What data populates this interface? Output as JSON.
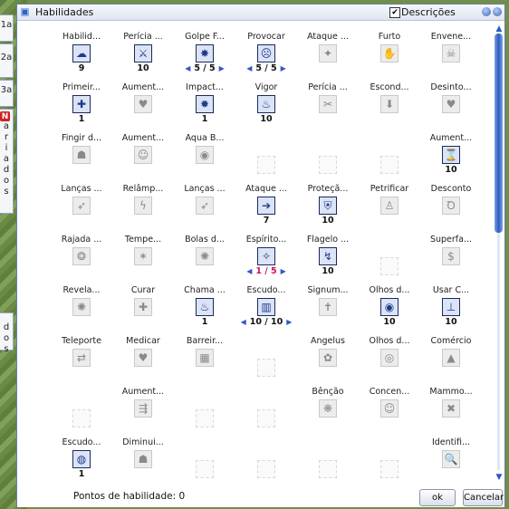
{
  "side_tabs": {
    "tab1": "1a",
    "tab2": "2a",
    "tab3": "3a",
    "tab4_badge": "N",
    "tab4_letters": [
      "a",
      "r",
      "i",
      "a",
      "d",
      "o",
      "s"
    ],
    "tab5_letters": [
      "d",
      "o",
      "s"
    ]
  },
  "window": {
    "title": "Habilidades",
    "descriptions_label": "Descrições",
    "descriptions_checked": "✔"
  },
  "skills": [
    {
      "name": "Habilid...",
      "level": "9",
      "active": true,
      "glyph": "☁"
    },
    {
      "name": "Perícia ...",
      "level": "10",
      "active": true,
      "glyph": "⚔"
    },
    {
      "name": "Golpe F...",
      "level": "5 / 5",
      "active": true,
      "glyph": "✸",
      "arrows": true
    },
    {
      "name": "Provocar",
      "level": "5 / 5",
      "active": true,
      "glyph": "☹",
      "arrows": true
    },
    {
      "name": "Ataque ...",
      "level": "",
      "active": false,
      "glyph": "✦"
    },
    {
      "name": "Furto",
      "level": "",
      "active": false,
      "glyph": "✋"
    },
    {
      "name": "Envene...",
      "level": "",
      "active": false,
      "glyph": "☠"
    },
    {
      "name": "Primeir...",
      "level": "1",
      "active": true,
      "glyph": "✚"
    },
    {
      "name": "Aument...",
      "level": "",
      "active": false,
      "glyph": "♥"
    },
    {
      "name": "Impact...",
      "level": "1",
      "active": true,
      "glyph": "✹"
    },
    {
      "name": "Vigor",
      "level": "10",
      "active": true,
      "glyph": "♨"
    },
    {
      "name": "Perícia ...",
      "level": "",
      "active": false,
      "glyph": "✂"
    },
    {
      "name": "Escond...",
      "level": "",
      "active": false,
      "glyph": "⬇"
    },
    {
      "name": "Desinto...",
      "level": "",
      "active": false,
      "glyph": "♥"
    },
    {
      "name": "Fingir d...",
      "level": "",
      "active": false,
      "glyph": "☗"
    },
    {
      "name": "Aument...",
      "level": "",
      "active": false,
      "glyph": "☺"
    },
    {
      "name": "Aqua B...",
      "level": "",
      "active": false,
      "glyph": "◉"
    },
    {
      "name": "",
      "level": "",
      "empty": true
    },
    {
      "name": "",
      "level": "",
      "empty": true
    },
    {
      "name": "",
      "level": "",
      "empty": true
    },
    {
      "name": "Aument...",
      "level": "10",
      "active": true,
      "glyph": "⌛"
    },
    {
      "name": "Lanças ...",
      "level": "",
      "active": false,
      "glyph": "➶"
    },
    {
      "name": "Relâmp...",
      "level": "",
      "active": false,
      "glyph": "ϟ"
    },
    {
      "name": "Lanças ...",
      "level": "",
      "active": false,
      "glyph": "➶"
    },
    {
      "name": "Ataque ...",
      "level": "7",
      "active": true,
      "glyph": "➔"
    },
    {
      "name": "Proteçã...",
      "level": "10",
      "active": true,
      "glyph": "⛨"
    },
    {
      "name": "Petrificar",
      "level": "",
      "active": false,
      "glyph": "♙"
    },
    {
      "name": "Desconto",
      "level": "",
      "active": false,
      "glyph": "Ꝺ"
    },
    {
      "name": "Rajada ...",
      "level": "",
      "active": false,
      "glyph": "❂"
    },
    {
      "name": "Tempe...",
      "level": "",
      "active": false,
      "glyph": "✶"
    },
    {
      "name": "Bolas d...",
      "level": "",
      "active": false,
      "glyph": "✺"
    },
    {
      "name": "Espírito...",
      "level": "1 / 5",
      "active": true,
      "glyph": "✧",
      "arrows": true,
      "red": true
    },
    {
      "name": "Flagelo ...",
      "level": "10",
      "active": true,
      "glyph": "↯"
    },
    {
      "name": "",
      "level": "",
      "empty": true
    },
    {
      "name": "Superfa...",
      "level": "",
      "active": false,
      "glyph": "$"
    },
    {
      "name": "Revela...",
      "level": "",
      "active": false,
      "glyph": "✺"
    },
    {
      "name": "Curar",
      "level": "",
      "active": false,
      "glyph": "✚"
    },
    {
      "name": "Chama ...",
      "level": "1",
      "active": true,
      "glyph": "♨"
    },
    {
      "name": "Escudo...",
      "level": "10 / 10",
      "active": true,
      "glyph": "▥",
      "arrows": true
    },
    {
      "name": "Signum...",
      "level": "",
      "active": false,
      "glyph": "✝"
    },
    {
      "name": "Olhos d...",
      "level": "10",
      "active": true,
      "glyph": "◉"
    },
    {
      "name": "Usar C...",
      "level": "10",
      "active": true,
      "glyph": "⊥"
    },
    {
      "name": "Teleporte",
      "level": "",
      "active": false,
      "glyph": "⇄"
    },
    {
      "name": "Medicar",
      "level": "",
      "active": false,
      "glyph": "♥"
    },
    {
      "name": "Barreir...",
      "level": "",
      "active": false,
      "glyph": "▦"
    },
    {
      "name": "",
      "level": "",
      "empty": true
    },
    {
      "name": "Angelus",
      "level": "",
      "active": false,
      "glyph": "✿"
    },
    {
      "name": "Olhos d...",
      "level": "",
      "active": false,
      "glyph": "◎"
    },
    {
      "name": "Comércio",
      "level": "",
      "active": false,
      "glyph": "▲"
    },
    {
      "name": "",
      "level": "",
      "empty": true
    },
    {
      "name": "Aument...",
      "level": "",
      "active": false,
      "glyph": "⇶"
    },
    {
      "name": "",
      "level": "",
      "empty": true
    },
    {
      "name": "",
      "level": "",
      "empty": true
    },
    {
      "name": "Bênção",
      "level": "",
      "active": false,
      "glyph": "❋"
    },
    {
      "name": "Concen...",
      "level": "",
      "active": false,
      "glyph": "☺"
    },
    {
      "name": "Mammo...",
      "level": "",
      "active": false,
      "glyph": "✖"
    },
    {
      "name": "Escudo...",
      "level": "1",
      "active": true,
      "glyph": "◍"
    },
    {
      "name": "Diminui...",
      "level": "",
      "active": false,
      "glyph": "☗"
    },
    {
      "name": "",
      "level": "",
      "empty": true
    },
    {
      "name": "",
      "level": "",
      "empty": true
    },
    {
      "name": "",
      "level": "",
      "empty": true
    },
    {
      "name": "",
      "level": "",
      "empty": true
    },
    {
      "name": "Identifi...",
      "level": "",
      "active": false,
      "glyph": "🔍"
    }
  ],
  "footer": {
    "points_label": "Pontos de habilidade: 0",
    "ok": "ok",
    "cancel": "Cancelar"
  },
  "colors": {
    "accent": "#3257c7",
    "skill_points_red": "#d01060"
  }
}
